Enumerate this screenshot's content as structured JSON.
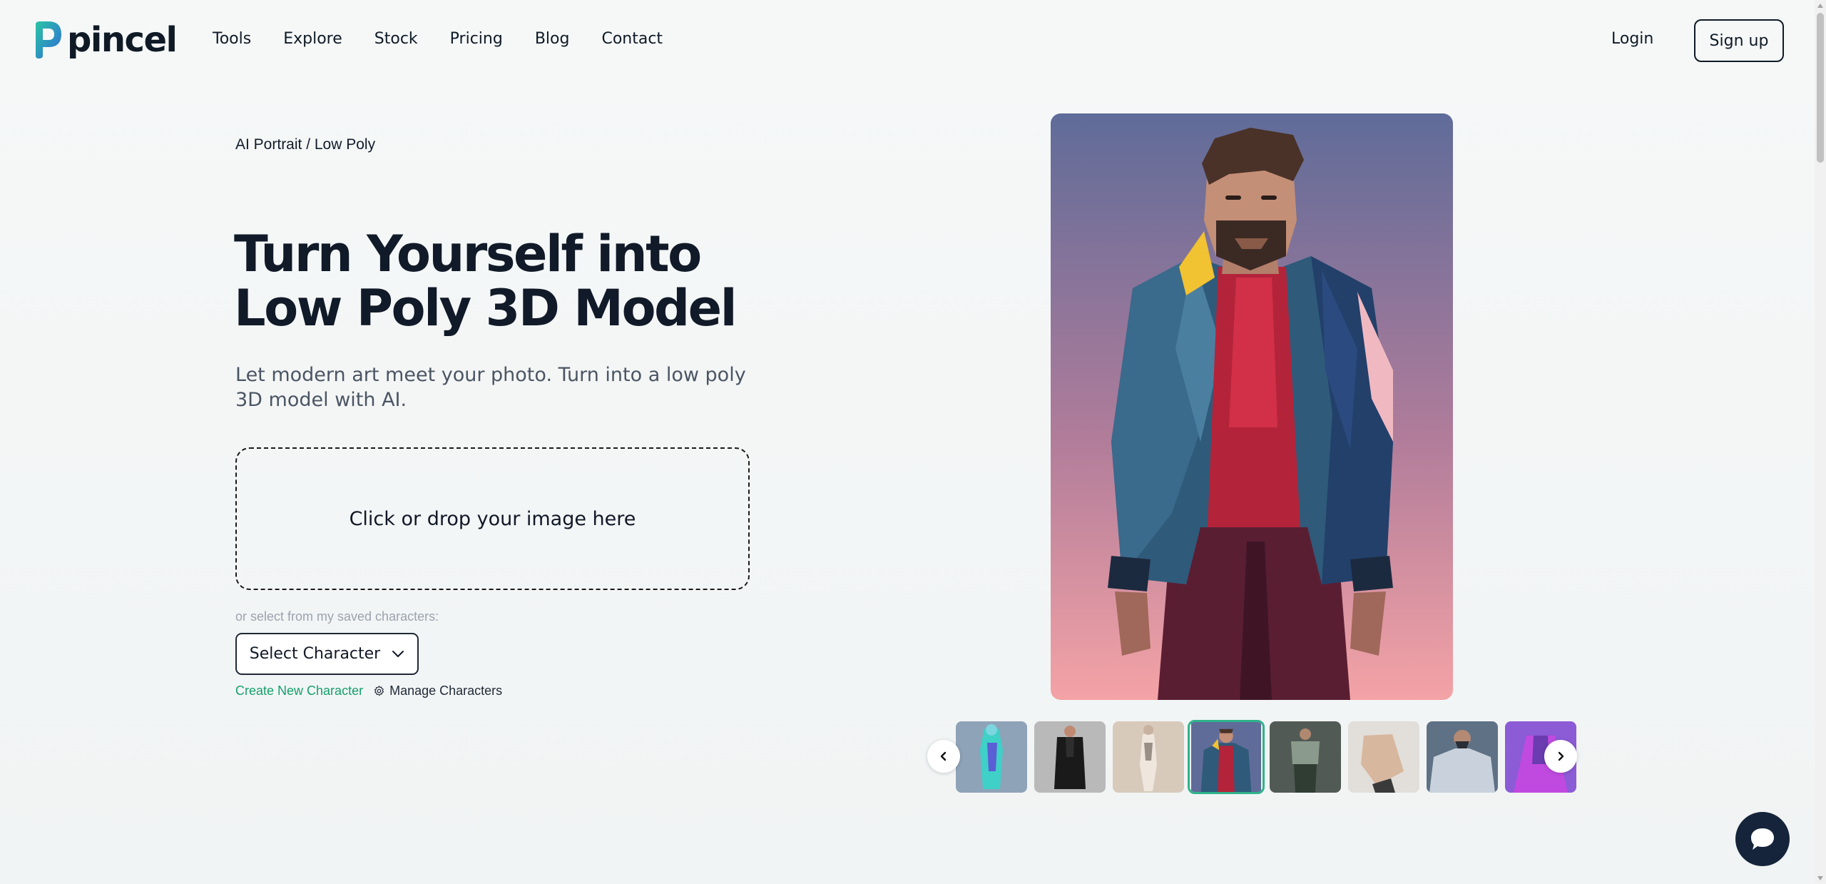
{
  "brand": {
    "name": "pincel",
    "colors": {
      "accent_green": "#15a06b",
      "dark": "#0f1a26",
      "logo_teal": "#2bc4a4",
      "logo_blue": "#2e6bd8"
    }
  },
  "nav": {
    "items": [
      "Tools",
      "Explore",
      "Stock",
      "Pricing",
      "Blog",
      "Contact"
    ]
  },
  "auth": {
    "login": "Login",
    "signup": "Sign up"
  },
  "breadcrumb": "AI Portrait / Low Poly",
  "hero": {
    "title_line1": "Turn Yourself into",
    "title_line2": "Low Poly 3D Model",
    "subtitle": "Let modern art meet your photo. Turn into a low poly 3D model with AI."
  },
  "upload": {
    "dropzone_text": "Click or drop your image here"
  },
  "characters": {
    "saved_label": "or select from my saved characters:",
    "select_label": "Select Character",
    "create_link": "Create New Character",
    "manage_link": "Manage Characters"
  },
  "preview": {
    "subject": "low poly man in blue jacket with red shirt",
    "background": [
      "#5f6c99",
      "#b67c98",
      "#f4a6a6"
    ]
  },
  "gallery": {
    "selected_index": 3,
    "thumbnails": [
      {
        "name": "neon-figure",
        "colors": [
          "#8fa3b8",
          "#3fd0c8",
          "#5b5fd6"
        ]
      },
      {
        "name": "dark-suit",
        "colors": [
          "#b9b9b9",
          "#2e2e2e",
          "#1a1a1a"
        ]
      },
      {
        "name": "light-figure",
        "colors": [
          "#d8cabb",
          "#efe6dd",
          "#9a8f86"
        ]
      },
      {
        "name": "blue-jacket",
        "colors": [
          "#5f6c99",
          "#2f5a7a",
          "#b3243a"
        ]
      },
      {
        "name": "green-figure",
        "colors": [
          "#525a56",
          "#2f3d33",
          "#8a9a8c"
        ]
      },
      {
        "name": "beige-shirt",
        "colors": [
          "#e2ded9",
          "#d7b79e",
          "#3a3a3a"
        ]
      },
      {
        "name": "grey-shirt",
        "colors": [
          "#5f7185",
          "#c9d2dc",
          "#2a2e36"
        ]
      },
      {
        "name": "purple-figure",
        "colors": [
          "#8c5bd6",
          "#c04ae0",
          "#6a3cb0"
        ]
      }
    ]
  },
  "icons": {
    "logo": "pincel-logo-icon",
    "chevron": "chevron-down-icon",
    "gear": "gear-icon",
    "prev": "chevron-left-icon",
    "next": "chevron-right-icon",
    "chat": "chat-bubble-icon"
  }
}
